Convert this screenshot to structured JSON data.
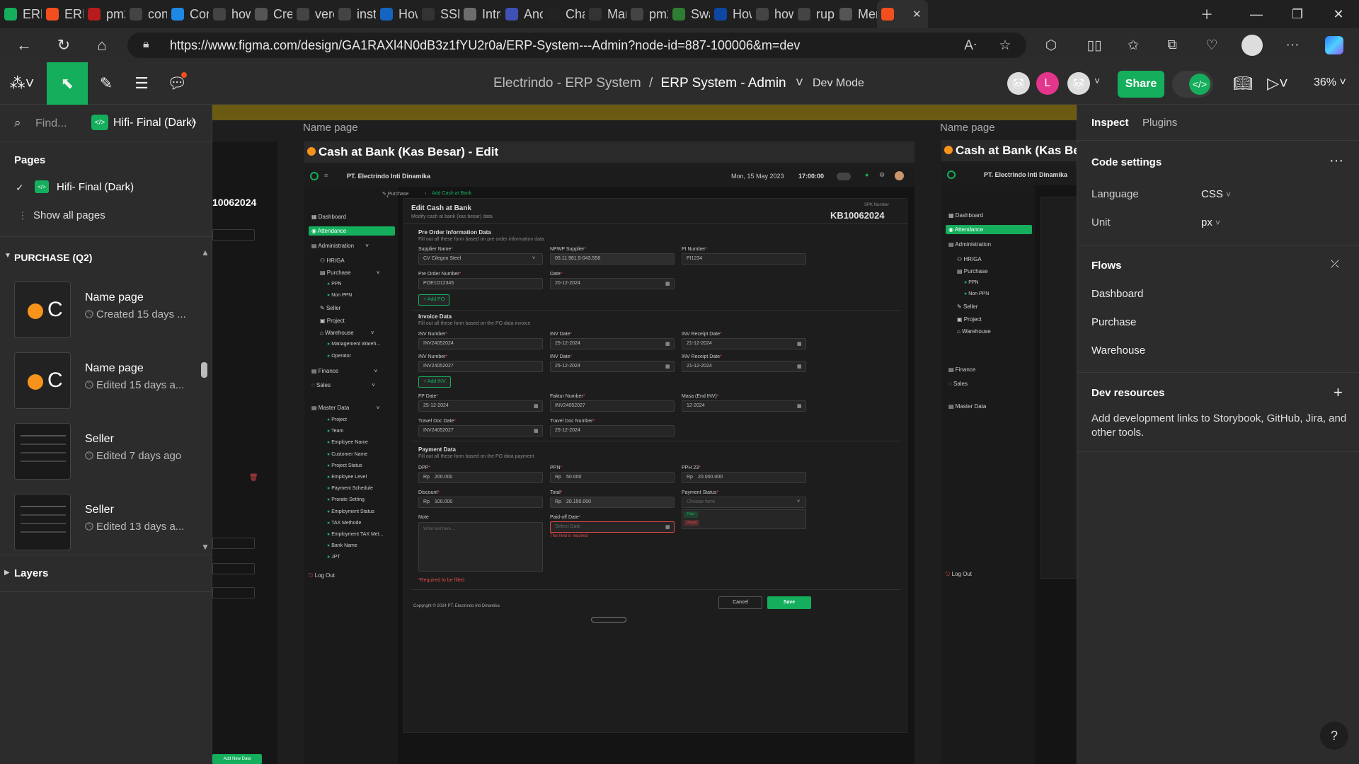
{
  "browser": {
    "tabs": [
      {
        "label": "ERP",
        "color": "#14ae5c"
      },
      {
        "label": "ERP",
        "color": "#f24e1e"
      },
      {
        "label": "pm2",
        "color": "#b71c1c"
      },
      {
        "label": "cont",
        "color": "#444"
      },
      {
        "label": "Con",
        "color": "#1e88e5"
      },
      {
        "label": "how",
        "color": "#444"
      },
      {
        "label": "Crea",
        "color": "#555"
      },
      {
        "label": "verc",
        "color": "#444"
      },
      {
        "label": "insta",
        "color": "#444"
      },
      {
        "label": "How",
        "color": "#1565c0"
      },
      {
        "label": "SSH",
        "color": "#333"
      },
      {
        "label": "Intro",
        "color": "#6d6d6d"
      },
      {
        "label": "Anch",
        "color": "#3f51b5"
      },
      {
        "label": "Chat",
        "color": "#222"
      },
      {
        "label": "Man",
        "color": "#333"
      },
      {
        "label": "pm2",
        "color": "#444"
      },
      {
        "label": "Swa",
        "color": "#2e7d32"
      },
      {
        "label": "How",
        "color": "#0d47a1"
      },
      {
        "label": "how",
        "color": "#444"
      },
      {
        "label": "rupi",
        "color": "#444"
      },
      {
        "label": "Mer",
        "color": "#555"
      },
      {
        "label": "",
        "color": "#f24e1e"
      }
    ],
    "url": "https://www.figma.com/design/GA1RAXl4N0dB3z1fYU2r0a/ERP-System---Admin?node-id=887-100006&m=dev"
  },
  "figma": {
    "project": "Electrindo - ERP System",
    "separator": "/",
    "file": "ERP System - Admin",
    "dev_mode": "Dev Mode",
    "avatar_letter": "L",
    "share": "Share",
    "zoom": "36%"
  },
  "left_panel": {
    "find_placeholder": "Find...",
    "current_page": "Hifi- Final (Dark)",
    "pages_header": "Pages",
    "page_name": "Hifi- Final (Dark)",
    "show_all": "Show all pages",
    "section": "PURCHASE (Q2)",
    "items": [
      {
        "title": "Name page",
        "sub": "Created 15 days ..."
      },
      {
        "title": "Name page",
        "sub": "Edited 15 days a..."
      },
      {
        "title": "Seller",
        "sub": "Edited 7 days ago"
      },
      {
        "title": "Seller",
        "sub": "Edited 13 days a..."
      }
    ],
    "layers": "Layers"
  },
  "canvas": {
    "left_frame_number": "10062024",
    "left_add_new": "Add New Data",
    "name_page_label": "Name page",
    "frame_title": "Cash at Bank (Kas Besar) - Edit",
    "right_name_page": "Name page",
    "right_frame_title": "Cash at Bank (Kas Besar",
    "app": {
      "company": "PT. Electrindo Inti Dinamika",
      "date": "Mon, 15 May 2023",
      "time": "17:00:00",
      "breadcrumb_1": "Purchase",
      "breadcrumb_2": "Add Cash at Bank",
      "page_title": "Edit Cash at Bank",
      "page_sub": "Modify cash at bank (kas besar) data",
      "spk_label": "SPK Number",
      "spk_number": "KB10062024",
      "sidebar": {
        "dashboard": "Dashboard",
        "attendance": "Attendance",
        "administration": "Administration",
        "hrga": "HR/GA",
        "purchase": "Purchase",
        "ppn": "PPN",
        "nonppn": "Non PPN",
        "seller": "Seller",
        "project": "Project",
        "warehouse": "Warehouse",
        "mgmt_wh": "Management Wareh...",
        "operator": "Operator",
        "finance": "Finance",
        "sales": "Sales",
        "master": "Master Data",
        "master_items": [
          "Project",
          "Team",
          "Employee Name",
          "Customer Name",
          "Project Status",
          "Employee Level",
          "Payment Schedule",
          "Prorate Setting",
          "Employment Status",
          "TAX Methode",
          "Employment TAX Met...",
          "Bank Name",
          "JPT"
        ],
        "logout": "Log Out"
      },
      "po": {
        "title": "Pre Order Information Data",
        "sub": "Fill out all these form based on pre order information data",
        "supplier_label": "Supplier Name",
        "supplier": "CV Cilegon Steel",
        "npwp_label": "NPWP Supplier",
        "npwp": "05.11.981.5-043.558",
        "pi_label": "PI Number",
        "pi": "PI1234",
        "po_label": "Pre Order Number",
        "po": "POE1D12345",
        "date_label": "Date",
        "date": "20-12-2024",
        "add_po": "+ Add PO"
      },
      "inv": {
        "title": "Invoice Data",
        "sub": "Fill out all these form based on the PO data invoice",
        "rows": [
          {
            "num": "INV24052024",
            "date": "25-12-2024",
            "receipt": "21-12-2024"
          },
          {
            "num": "INV24052027",
            "date": "25-12-2024",
            "receipt": "21-12-2024"
          }
        ],
        "num_label": "INV Number",
        "date_label": "INV Date",
        "receipt_label": "INV Receipt Date",
        "add_inv": "+ Add INV",
        "fp_label": "FP Date",
        "fp": "25-12-2024",
        "faktur_label": "Faktur Number",
        "faktur": "INV24052027",
        "masa_label": "Masa (End INV)",
        "masa": "12-2024",
        "tdd_label": "Travel Doc Date",
        "tdd": "INV24052027",
        "tdn_label": "Travel Doc Number",
        "tdn": "25-12-2024"
      },
      "pay": {
        "title": "Payment Data",
        "sub": "Fill out all these form based on the PO data payment",
        "rp": "Rp",
        "dpp_label": "DPP",
        "dpp": "200.000",
        "ppn_label": "PPN",
        "ppn": "50.000",
        "pph_label": "PPH 23",
        "pph": "20.000.000",
        "disc_label": "Discount",
        "disc": "100.000",
        "total_label": "Total",
        "total": "20.150.000",
        "status_label": "Payment Status",
        "status_placeholder": "Choose here",
        "status_opt1": "Paid",
        "status_opt2": "Unpaid",
        "note_label": "Note",
        "note_placeholder": "Write text here ...",
        "paidoff_label": "Paid-off Date",
        "paidoff_placeholder": "Select Date",
        "paidoff_error": "This field is required",
        "required": "*Required to be filled"
      },
      "cancel": "Cancel",
      "save": "Save",
      "copyright": "Copyright © 2024 PT. Electrindo Inti Dinamika"
    }
  },
  "right_panel": {
    "tab_inspect": "Inspect",
    "tab_plugins": "Plugins",
    "code_settings": "Code settings",
    "language_label": "Language",
    "language": "CSS",
    "unit_label": "Unit",
    "unit": "px",
    "flows": "Flows",
    "flow_items": [
      "Dashboard",
      "Purchase",
      "Warehouse"
    ],
    "dev_resources": "Dev resources",
    "dev_resources_text_1": "Add development links to Storybook, GitHub, Jira, and",
    "dev_resources_text_2": "other tools."
  },
  "colors": {
    "accent": "#14ae5c",
    "figma_red": "#f24e1e",
    "banner": "#6b5a12"
  }
}
